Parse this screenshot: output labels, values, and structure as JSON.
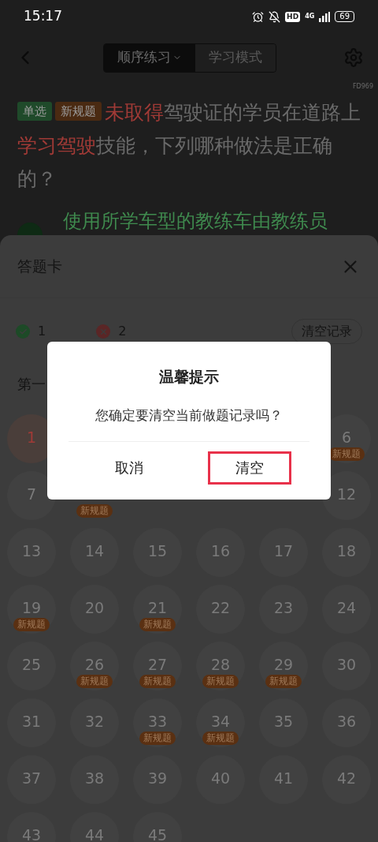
{
  "status_bar": {
    "time": "15:17",
    "network": "4G",
    "hd": "HD",
    "battery": "69"
  },
  "header": {
    "tabs": [
      {
        "label": "顺序练习",
        "selected": true,
        "dropdown": true
      },
      {
        "label": "学习模式",
        "selected": false,
        "dropdown": false
      }
    ],
    "code": "FD969"
  },
  "question": {
    "tags": [
      {
        "label": "单选",
        "color": "#1f4a2a"
      },
      {
        "label": "新规题",
        "color": "#4a2a12"
      }
    ],
    "segments": [
      {
        "text": "未取得",
        "highlight": true
      },
      {
        "text": "驾驶证的学员在道路上",
        "highlight": false
      },
      {
        "text": "学习驾驶",
        "highlight": true
      },
      {
        "text": "技能，下列哪种做法是正确的？",
        "highlight": false
      }
    ],
    "option": "使用所学车型的教练车由教练员"
  },
  "sheet": {
    "title": "答题卡",
    "correct": "1",
    "wrong": "2",
    "clear_button": "清空记录",
    "section": "第一",
    "cells": [
      {
        "kind": "number",
        "label": "1",
        "wrong": true
      },
      {
        "kind": "covered"
      },
      {
        "kind": "covered"
      },
      {
        "kind": "covered"
      },
      {
        "kind": "covered"
      },
      {
        "kind": "number",
        "label": "6",
        "wrong": false,
        "badge": "新规题"
      },
      {
        "kind": "number",
        "label": "7",
        "wrong": false
      },
      {
        "kind": "covered",
        "badge": "新规题"
      },
      {
        "kind": "covered"
      },
      {
        "kind": "covered"
      },
      {
        "kind": "covered"
      },
      {
        "kind": "number",
        "label": "12",
        "wrong": false
      },
      {
        "kind": "number",
        "label": "13",
        "wrong": false
      },
      {
        "kind": "number",
        "label": "14",
        "wrong": false
      },
      {
        "kind": "number",
        "label": "15",
        "wrong": false
      },
      {
        "kind": "number",
        "label": "16",
        "wrong": false
      },
      {
        "kind": "number",
        "label": "17",
        "wrong": false
      },
      {
        "kind": "number",
        "label": "18",
        "wrong": false
      },
      {
        "kind": "number",
        "label": "19",
        "wrong": false,
        "badge": "新规题"
      },
      {
        "kind": "number",
        "label": "20",
        "wrong": false
      },
      {
        "kind": "number",
        "label": "21",
        "wrong": false,
        "badge": "新规题"
      },
      {
        "kind": "number",
        "label": "22",
        "wrong": false
      },
      {
        "kind": "number",
        "label": "23",
        "wrong": false
      },
      {
        "kind": "number",
        "label": "24",
        "wrong": false
      },
      {
        "kind": "number",
        "label": "25",
        "wrong": false
      },
      {
        "kind": "number",
        "label": "26",
        "wrong": false,
        "badge": "新规题"
      },
      {
        "kind": "number",
        "label": "27",
        "wrong": false,
        "badge": "新规题"
      },
      {
        "kind": "number",
        "label": "28",
        "wrong": false,
        "badge": "新规题"
      },
      {
        "kind": "number",
        "label": "29",
        "wrong": false,
        "badge": "新规题"
      },
      {
        "kind": "number",
        "label": "30",
        "wrong": false
      },
      {
        "kind": "number",
        "label": "31",
        "wrong": false
      },
      {
        "kind": "number",
        "label": "32",
        "wrong": false
      },
      {
        "kind": "number",
        "label": "33",
        "wrong": false,
        "badge": "新规题"
      },
      {
        "kind": "number",
        "label": "34",
        "wrong": false,
        "badge": "新规题"
      },
      {
        "kind": "number",
        "label": "35",
        "wrong": false
      },
      {
        "kind": "number",
        "label": "36",
        "wrong": false
      },
      {
        "kind": "number",
        "label": "37",
        "wrong": false
      },
      {
        "kind": "number",
        "label": "38",
        "wrong": false
      },
      {
        "kind": "number",
        "label": "39",
        "wrong": false
      },
      {
        "kind": "number",
        "label": "40",
        "wrong": false
      },
      {
        "kind": "number",
        "label": "41",
        "wrong": false
      },
      {
        "kind": "number",
        "label": "42",
        "wrong": false
      },
      {
        "kind": "number",
        "label": "43",
        "wrong": false
      },
      {
        "kind": "number",
        "label": "44",
        "wrong": false
      },
      {
        "kind": "number",
        "label": "45",
        "wrong": false
      }
    ]
  },
  "dialog": {
    "title": "温馨提示",
    "message": "您确定要清空当前做题记录吗？",
    "buttons": [
      {
        "label": "取消",
        "outlined": false
      },
      {
        "label": "清空",
        "outlined": true
      }
    ]
  }
}
